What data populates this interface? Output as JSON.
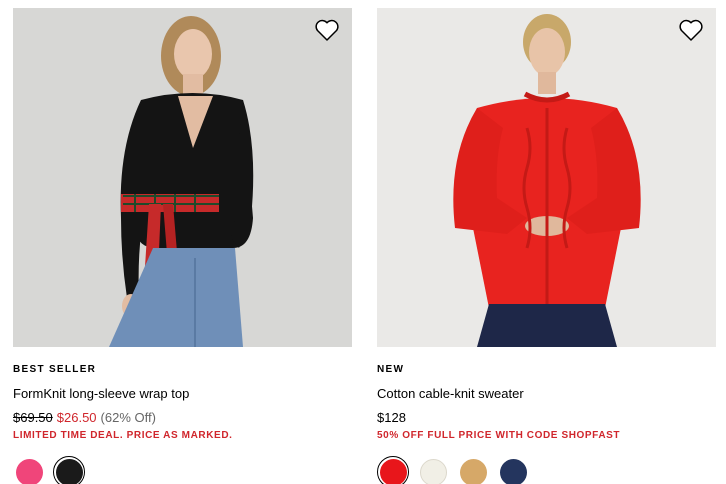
{
  "products": [
    {
      "badge": "BEST SELLER",
      "name": "FormKnit long-sleeve wrap top",
      "price_was": "$69.50",
      "price_now": "$26.50",
      "discount": "(62% Off)",
      "promo": "LIMITED TIME DEAL. PRICE AS MARKED.",
      "wishlist_icon": "heart-outline-icon",
      "swatches": [
        {
          "color": "#f0457a",
          "selected": false
        },
        {
          "color": "#1a1a1a",
          "selected": true
        }
      ]
    },
    {
      "badge": "NEW",
      "name": "Cotton cable-knit sweater",
      "price": "$128",
      "promo": "50% OFF FULL PRICE WITH CODE SHOPFAST",
      "wishlist_icon": "heart-outline-icon",
      "swatches": [
        {
          "color": "#e8161b",
          "selected": true
        },
        {
          "color": "#f1efe6",
          "selected": false
        },
        {
          "color": "#d6a868",
          "selected": false
        },
        {
          "color": "#24355e",
          "selected": false
        }
      ]
    }
  ],
  "colors": {
    "sale_red": "#d0262c",
    "text": "#000000"
  }
}
